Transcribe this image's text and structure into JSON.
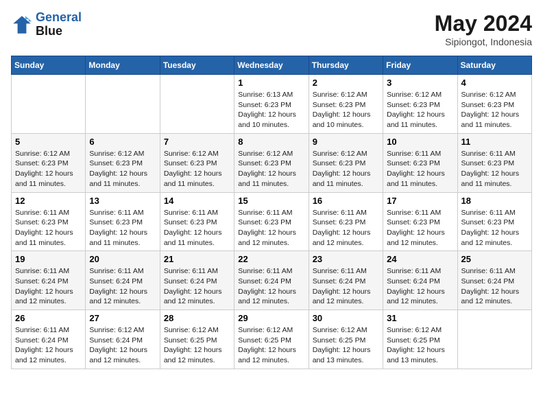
{
  "logo": {
    "line1": "General",
    "line2": "Blue"
  },
  "title": "May 2024",
  "location": "Sipiongot, Indonesia",
  "days_of_week": [
    "Sunday",
    "Monday",
    "Tuesday",
    "Wednesday",
    "Thursday",
    "Friday",
    "Saturday"
  ],
  "weeks": [
    [
      {
        "day": "",
        "info": ""
      },
      {
        "day": "",
        "info": ""
      },
      {
        "day": "",
        "info": ""
      },
      {
        "day": "1",
        "info": "Sunrise: 6:13 AM\nSunset: 6:23 PM\nDaylight: 12 hours\nand 10 minutes."
      },
      {
        "day": "2",
        "info": "Sunrise: 6:12 AM\nSunset: 6:23 PM\nDaylight: 12 hours\nand 10 minutes."
      },
      {
        "day": "3",
        "info": "Sunrise: 6:12 AM\nSunset: 6:23 PM\nDaylight: 12 hours\nand 11 minutes."
      },
      {
        "day": "4",
        "info": "Sunrise: 6:12 AM\nSunset: 6:23 PM\nDaylight: 12 hours\nand 11 minutes."
      }
    ],
    [
      {
        "day": "5",
        "info": "Sunrise: 6:12 AM\nSunset: 6:23 PM\nDaylight: 12 hours\nand 11 minutes."
      },
      {
        "day": "6",
        "info": "Sunrise: 6:12 AM\nSunset: 6:23 PM\nDaylight: 12 hours\nand 11 minutes."
      },
      {
        "day": "7",
        "info": "Sunrise: 6:12 AM\nSunset: 6:23 PM\nDaylight: 12 hours\nand 11 minutes."
      },
      {
        "day": "8",
        "info": "Sunrise: 6:12 AM\nSunset: 6:23 PM\nDaylight: 12 hours\nand 11 minutes."
      },
      {
        "day": "9",
        "info": "Sunrise: 6:12 AM\nSunset: 6:23 PM\nDaylight: 12 hours\nand 11 minutes."
      },
      {
        "day": "10",
        "info": "Sunrise: 6:11 AM\nSunset: 6:23 PM\nDaylight: 12 hours\nand 11 minutes."
      },
      {
        "day": "11",
        "info": "Sunrise: 6:11 AM\nSunset: 6:23 PM\nDaylight: 12 hours\nand 11 minutes."
      }
    ],
    [
      {
        "day": "12",
        "info": "Sunrise: 6:11 AM\nSunset: 6:23 PM\nDaylight: 12 hours\nand 11 minutes."
      },
      {
        "day": "13",
        "info": "Sunrise: 6:11 AM\nSunset: 6:23 PM\nDaylight: 12 hours\nand 11 minutes."
      },
      {
        "day": "14",
        "info": "Sunrise: 6:11 AM\nSunset: 6:23 PM\nDaylight: 12 hours\nand 11 minutes."
      },
      {
        "day": "15",
        "info": "Sunrise: 6:11 AM\nSunset: 6:23 PM\nDaylight: 12 hours\nand 12 minutes."
      },
      {
        "day": "16",
        "info": "Sunrise: 6:11 AM\nSunset: 6:23 PM\nDaylight: 12 hours\nand 12 minutes."
      },
      {
        "day": "17",
        "info": "Sunrise: 6:11 AM\nSunset: 6:23 PM\nDaylight: 12 hours\nand 12 minutes."
      },
      {
        "day": "18",
        "info": "Sunrise: 6:11 AM\nSunset: 6:23 PM\nDaylight: 12 hours\nand 12 minutes."
      }
    ],
    [
      {
        "day": "19",
        "info": "Sunrise: 6:11 AM\nSunset: 6:24 PM\nDaylight: 12 hours\nand 12 minutes."
      },
      {
        "day": "20",
        "info": "Sunrise: 6:11 AM\nSunset: 6:24 PM\nDaylight: 12 hours\nand 12 minutes."
      },
      {
        "day": "21",
        "info": "Sunrise: 6:11 AM\nSunset: 6:24 PM\nDaylight: 12 hours\nand 12 minutes."
      },
      {
        "day": "22",
        "info": "Sunrise: 6:11 AM\nSunset: 6:24 PM\nDaylight: 12 hours\nand 12 minutes."
      },
      {
        "day": "23",
        "info": "Sunrise: 6:11 AM\nSunset: 6:24 PM\nDaylight: 12 hours\nand 12 minutes."
      },
      {
        "day": "24",
        "info": "Sunrise: 6:11 AM\nSunset: 6:24 PM\nDaylight: 12 hours\nand 12 minutes."
      },
      {
        "day": "25",
        "info": "Sunrise: 6:11 AM\nSunset: 6:24 PM\nDaylight: 12 hours\nand 12 minutes."
      }
    ],
    [
      {
        "day": "26",
        "info": "Sunrise: 6:11 AM\nSunset: 6:24 PM\nDaylight: 12 hours\nand 12 minutes."
      },
      {
        "day": "27",
        "info": "Sunrise: 6:12 AM\nSunset: 6:24 PM\nDaylight: 12 hours\nand 12 minutes."
      },
      {
        "day": "28",
        "info": "Sunrise: 6:12 AM\nSunset: 6:25 PM\nDaylight: 12 hours\nand 12 minutes."
      },
      {
        "day": "29",
        "info": "Sunrise: 6:12 AM\nSunset: 6:25 PM\nDaylight: 12 hours\nand 12 minutes."
      },
      {
        "day": "30",
        "info": "Sunrise: 6:12 AM\nSunset: 6:25 PM\nDaylight: 12 hours\nand 13 minutes."
      },
      {
        "day": "31",
        "info": "Sunrise: 6:12 AM\nSunset: 6:25 PM\nDaylight: 12 hours\nand 13 minutes."
      },
      {
        "day": "",
        "info": ""
      }
    ]
  ]
}
